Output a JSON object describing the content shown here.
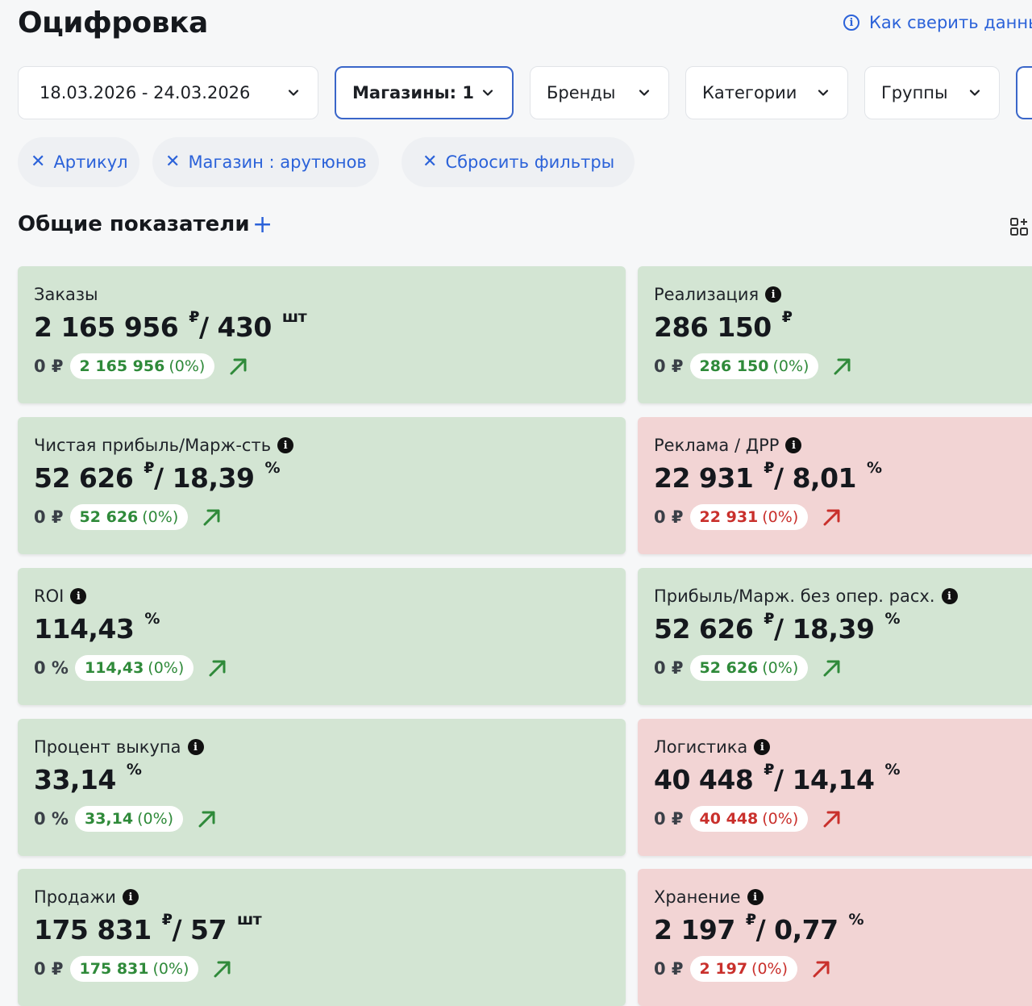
{
  "header": {
    "title": "Оцифровка",
    "help_link": "Как сверить данные"
  },
  "filters": {
    "date_range": "18.03.2026 - 24.03.2026",
    "stores": "Магазины: 1",
    "brands": "Бренды",
    "categories": "Категории",
    "groups": "Группы"
  },
  "chips": {
    "article": "Артикул",
    "store": "Магазин : арутюнов",
    "reset": "Сбросить фильтры"
  },
  "section": {
    "title": "Общие показатели"
  },
  "cards": {
    "orders": {
      "title": "Заказы",
      "value": "2 165 956",
      "unit1": "₽",
      "value2": "/ 430",
      "unit2": "шт",
      "prev": "0 ₽",
      "delta": "2 165 956",
      "pct": "(0%)",
      "status": "positive"
    },
    "sales_realization": {
      "title": "Реализация",
      "value": "286 150",
      "unit1": "₽",
      "prev": "0 ₽",
      "delta": "286 150",
      "pct": "(0%)",
      "status": "positive"
    },
    "net_profit": {
      "title": "Чистая прибыль/Марж-сть",
      "value": "52 626",
      "unit1": "₽",
      "value2": "/ 18,39",
      "unit2": "%",
      "prev": "0 ₽",
      "delta": "52 626",
      "pct": "(0%)",
      "status": "positive"
    },
    "ads": {
      "title": "Реклама / ДРР",
      "value": "22 931",
      "unit1": "₽",
      "value2": "/ 8,01",
      "unit2": "%",
      "prev": "0 ₽",
      "delta": "22 931",
      "pct": "(0%)",
      "status": "negative"
    },
    "roi": {
      "title": "ROI",
      "value": "114,43",
      "unit1": "%",
      "prev": "0 %",
      "delta": "114,43",
      "pct": "(0%)",
      "status": "positive"
    },
    "profit_no_opex": {
      "title": "Прибыль/Марж. без опер. расх.",
      "value": "52 626",
      "unit1": "₽",
      "value2": "/ 18,39",
      "unit2": "%",
      "prev": "0 ₽",
      "delta": "52 626",
      "pct": "(0%)",
      "status": "positive"
    },
    "buyout": {
      "title": "Процент выкупа",
      "value": "33,14",
      "unit1": "%",
      "prev": "0 %",
      "delta": "33,14",
      "pct": "(0%)",
      "status": "positive"
    },
    "logistics": {
      "title": "Логистика",
      "value": "40 448",
      "unit1": "₽",
      "value2": "/ 14,14",
      "unit2": "%",
      "prev": "0 ₽",
      "delta": "40 448",
      "pct": "(0%)",
      "status": "negative"
    },
    "sales": {
      "title": "Продажи",
      "value": "175 831",
      "unit1": "₽",
      "value2": "/ 57",
      "unit2": "шт",
      "prev": "0 ₽",
      "delta": "175 831",
      "pct": "(0%)",
      "status": "positive"
    },
    "storage": {
      "title": "Хранение",
      "value": "2 197",
      "unit1": "₽",
      "value2": "/ 0,77",
      "unit2": "%",
      "prev": "0 ₽",
      "delta": "2 197",
      "pct": "(0%)",
      "status": "negative"
    }
  },
  "colors": {
    "accent": "#2b62d9",
    "card_positive_bg": "#d3e5d3",
    "card_negative_bg": "#f2d4d4",
    "trend_positive": "#2f8a3a",
    "trend_negative": "#c9302c"
  }
}
